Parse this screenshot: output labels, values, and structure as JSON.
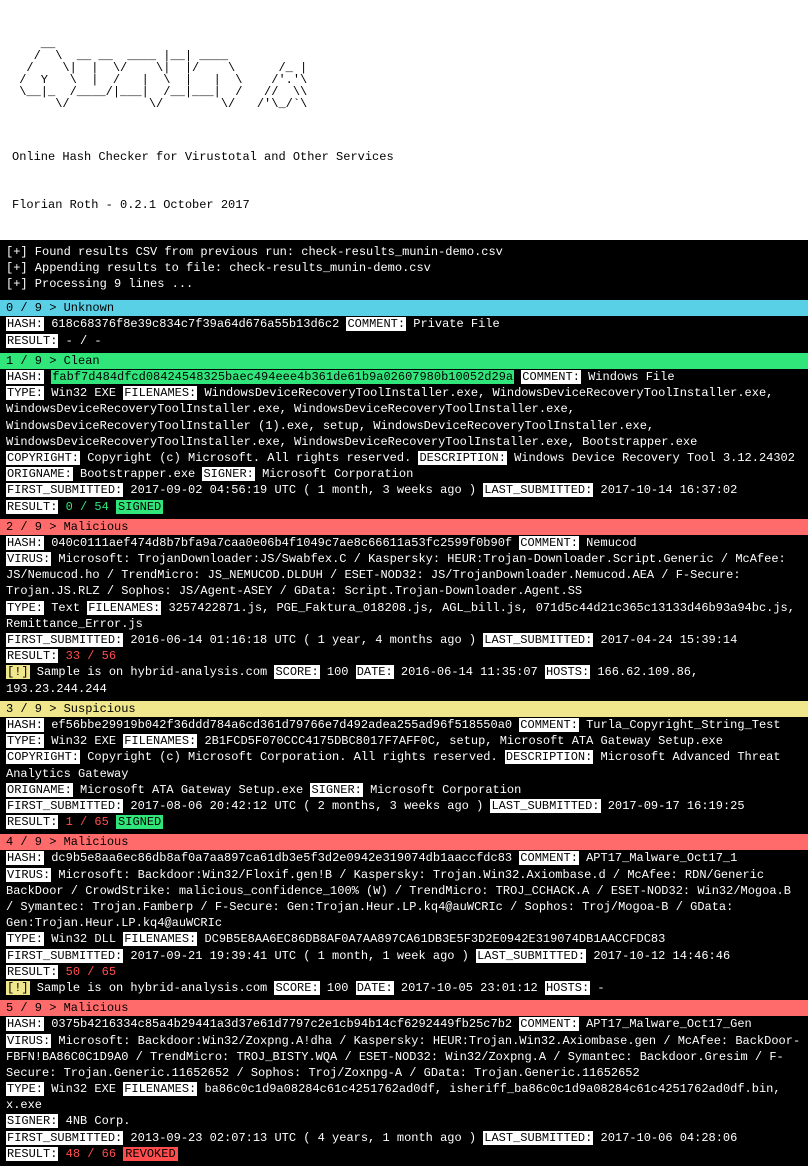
{
  "banner": {
    "ascii": "    __\n   /  \\  __ __  ____ |__| ____\n  /    \\|  |  \\/    \\|  |/    \\      /_ |\n /  Y   \\  |  /   |  \\  |   |  \\    /'.'\\\n \\__|_  /____/|___|  /__|___|  /   //  \\\\\n      \\/           \\/        \\/   /'\\_/`\\",
    "subtitle": "Online Hash Checker for Virustotal and Other Services",
    "authorline": "Florian Roth - 0.2.1 October 2017"
  },
  "runlines": [
    "[+] Found results CSV from previous run: check-results_munin-demo.csv",
    "[+] Appending results to file: check-results_munin-demo.csv",
    "[+] Processing 9 lines ..."
  ],
  "entries": [
    {
      "headerClass": "hdr-unknown",
      "header": "0 / 9 > Unknown",
      "hash": "618c68376f8e39c834c7f39a64d676a55b13d6c2",
      "comment": "Private File",
      "result": "- / -"
    },
    {
      "headerClass": "hdr-clean",
      "header": "1 / 9 > Clean",
      "hash": "fabf7d484dfcd08424548325baec494eee4b361de61b9a02607980b10052d29a",
      "hashHi": true,
      "comment": "Windows File",
      "type": "Win32 EXE",
      "filenames": "WindowsDeviceRecoveryToolInstaller.exe, WindowsDeviceRecoveryToolInstaller.exe, WindowsDeviceRecoveryToolInstaller.exe, WindowsDeviceRecoveryToolInstaller.exe, WindowsDeviceRecoveryToolInstaller (1).exe, setup, WindowsDeviceRecoveryToolInstaller.exe, WindowsDeviceRecoveryToolInstaller.exe, WindowsDeviceRecoveryToolInstaller.exe, Bootstrapper.exe",
      "copyright": "Copyright (c) Microsoft. All rights reserved.",
      "description": "Windows Device Recovery Tool 3.12.24302",
      "origname": "Bootstrapper.exe",
      "signer": "Microsoft Corporation",
      "first_submitted": "2017-09-02 04:56:19 UTC ( 1 month, 3 weeks ago )",
      "last_submitted": "2017-10-14 16:37:02",
      "result": "0 / 54",
      "resultClass": "green-txt",
      "signedTag": "SIGNED"
    },
    {
      "headerClass": "hdr-malicious",
      "header": "2 / 9 > Malicious",
      "hash": "040c0111aef474d8b7bfa9a7caa0e06b4f1049c7ae8c66611a53fc2599f0b90f",
      "comment": "Nemucod",
      "virus": "Microsoft: TrojanDownloader:JS/Swabfex.C / Kaspersky: HEUR:Trojan-Downloader.Script.Generic / McAfee: JS/Nemucod.ho / TrendMicro: JS_NEMUCOD.DLDUH / ESET-NOD32: JS/TrojanDownloader.Nemucod.AEA / F-Secure: Trojan.JS.RLZ / Sophos: JS/Agent-ASEY / GData: Script.Trojan-Downloader.Agent.SS",
      "type": "Text",
      "filenames": "3257422871.js, PGE_Faktura_018208.js, AGL_bill.js, 071d5c44d21c365c13133d46b93a94bc.js, Remittance_Error.js",
      "first_submitted": "2016-06-14 01:16:18 UTC ( 1 year, 4 months ago )",
      "last_submitted": "2017-04-24 15:39:14",
      "result": "33 / 56",
      "resultClass": "red-txt",
      "hybrid": {
        "score": "100",
        "date": "2016-06-14 11:35:07",
        "hosts": "166.62.109.86, 193.23.244.244"
      }
    },
    {
      "headerClass": "hdr-suspicious",
      "header": "3 / 9 > Suspicious",
      "hash": "ef56bbe29919b042f36ddd784a6cd361d79766e7d492adea255ad96f518550a0",
      "comment": "Turla_Copyright_String_Test",
      "type": "Win32 EXE",
      "filenames": "2B1FCD5F070CCC4175DBC8017F7AFF0C, setup, Microsoft ATA Gateway Setup.exe",
      "copyright": "Copyright (c) Microsoft Corporation. All rights reserved.",
      "description": "Microsoft Advanced Threat Analytics Gateway",
      "origname": "Microsoft ATA Gateway Setup.exe",
      "signer": "Microsoft Corporation",
      "first_submitted": "2017-08-06 20:42:12 UTC ( 2 months, 3 weeks ago )",
      "last_submitted": "2017-09-17 16:19:25",
      "result": "1 / 65",
      "resultClass": "red-txt",
      "signedTag": "SIGNED"
    },
    {
      "headerClass": "hdr-malicious",
      "header": "4 / 9 > Malicious",
      "hash": "dc9b5e8aa6ec86db8af0a7aa897ca61db3e5f3d2e0942e319074db1aaccfdc83",
      "comment": "APT17_Malware_Oct17_1",
      "virus": "Microsoft: Backdoor:Win32/Floxif.gen!B / Kaspersky: Trojan.Win32.Axiombase.d / McAfee: RDN/Generic BackDoor / CrowdStrike: malicious_confidence_100% (W) / TrendMicro: TROJ_CCHACK.A / ESET-NOD32: Win32/Mogoa.B / Symantec: Trojan.Famberp / F-Secure: Gen:Trojan.Heur.LP.kq4@auWCRIc / Sophos: Troj/Mogoa-B / GData: Gen:Trojan.Heur.LP.kq4@auWCRIc",
      "type": "Win32 DLL",
      "filenames": "DC9B5E8AA6EC86DB8AF0A7AA897CA61DB3E5F3D2E0942E319074DB1AACCFDC83",
      "first_submitted": "2017-09-21 19:39:41 UTC ( 1 month, 1 week ago )",
      "last_submitted": "2017-10-12 14:46:46",
      "result": "50 / 65",
      "resultClass": "red-txt",
      "hybrid": {
        "score": "100",
        "date": "2017-10-05 23:01:12",
        "hosts": "-"
      }
    },
    {
      "headerClass": "hdr-malicious",
      "header": "5 / 9 > Malicious",
      "hash": "0375b4216334c85a4b29441a3d37e61d7797c2e1cb94b14cf6292449fb25c7b2",
      "comment": "APT17_Malware_Oct17_Gen",
      "virus": "Microsoft: Backdoor:Win32/Zoxpng.A!dha / Kaspersky: HEUR:Trojan.Win32.Axiombase.gen / McAfee: BackDoor-FBFN!BA86C0C1D9A0 / TrendMicro: TROJ_BISTY.WQA / ESET-NOD32: Win32/Zoxpng.A / Symantec: Backdoor.Gresim / F-Secure: Trojan.Generic.11652652 / Sophos: Troj/Zoxnpg-A / GData: Trojan.Generic.11652652",
      "type": "Win32 EXE",
      "filenames": "ba86c0c1d9a08284c61c4251762ad0df, isheriff_ba86c0c1d9a08284c61c4251762ad0df.bin, x.exe",
      "signer": "4NB Corp.",
      "first_submitted": "2013-09-23 02:07:13 UTC ( 4 years, 1 month ago )",
      "last_submitted": "2017-10-06 04:28:06",
      "result": "48 / 66",
      "resultClass": "red-txt",
      "revokedTag": "REVOKED"
    }
  ],
  "labels": {
    "hash": "HASH:",
    "comment": "COMMENT:",
    "result": "RESULT:",
    "type": "TYPE:",
    "filenames": "FILENAMES:",
    "copyright": "COPYRIGHT:",
    "description": "DESCRIPTION:",
    "origname": "ORIGNAME:",
    "signer": "SIGNER:",
    "first_submitted": "FIRST_SUBMITTED:",
    "last_submitted": "LAST_SUBMITTED:",
    "virus": "VIRUS:",
    "score": "SCORE:",
    "date": "DATE:",
    "hosts": "HOSTS:",
    "hybrid_text": " Sample is on hybrid-analysis.com ",
    "bang": "[!]"
  }
}
